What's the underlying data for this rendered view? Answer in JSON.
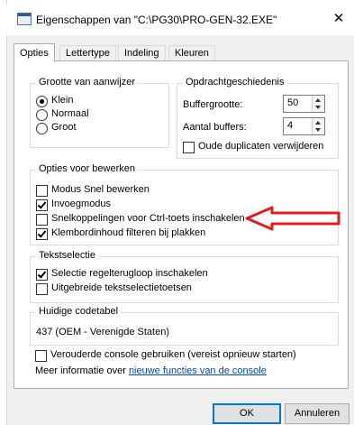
{
  "window": {
    "title": "Eigenschappen van \"C:\\PG30\\PRO-GEN-32.EXE\"",
    "close_glyph": "✕"
  },
  "tabs": [
    {
      "label": "Opties",
      "active": true
    },
    {
      "label": "Lettertype",
      "active": false
    },
    {
      "label": "Indeling",
      "active": false
    },
    {
      "label": "Kleuren",
      "active": false
    }
  ],
  "cursor_size": {
    "legend": "Grootte van aanwijzer",
    "options": [
      {
        "label": "Klein",
        "selected": true
      },
      {
        "label": "Normaal",
        "selected": false
      },
      {
        "label": "Groot",
        "selected": false
      }
    ]
  },
  "command_history": {
    "legend": "Opdrachtgeschiedenis",
    "buffer_size_label": "Buffergrootte:",
    "buffer_size_value": "50",
    "buffer_count_label": "Aantal buffers:",
    "buffer_count_value": "4",
    "discard_duplicates_label": "Oude duplicaten verwijderen",
    "discard_duplicates_checked": false
  },
  "edit_options": {
    "legend": "Opties voor bewerken",
    "items": [
      {
        "label": "Modus Snel bewerken",
        "checked": false
      },
      {
        "label": "Invoegmodus",
        "checked": true
      },
      {
        "label": "Snelkoppelingen voor Ctrl-toets inschakelen",
        "checked": false
      },
      {
        "label": "Klembordinhoud filteren bij plakken",
        "checked": true
      }
    ]
  },
  "text_selection": {
    "legend": "Tekstselectie",
    "items": [
      {
        "label": "Selectie regelterugloop inschakelen",
        "checked": true
      },
      {
        "label": "Uitgebreide tekstselectietoetsen",
        "checked": false
      }
    ]
  },
  "codepage": {
    "legend": "Huidige codetabel",
    "value": "437   (OEM - Verenigde Staten)"
  },
  "legacy_console": {
    "label": "Verouderde console gebruiken (vereist opnieuw starten)",
    "checked": false
  },
  "more_info": {
    "prefix": "Meer informatie over ",
    "link": "nieuwe functies van de console"
  },
  "buttons": {
    "ok": "OK",
    "cancel": "Annuleren"
  },
  "colors": {
    "annotation_arrow": "#e02020",
    "link": "#0645ad",
    "default_button_border": "#0078d7"
  }
}
